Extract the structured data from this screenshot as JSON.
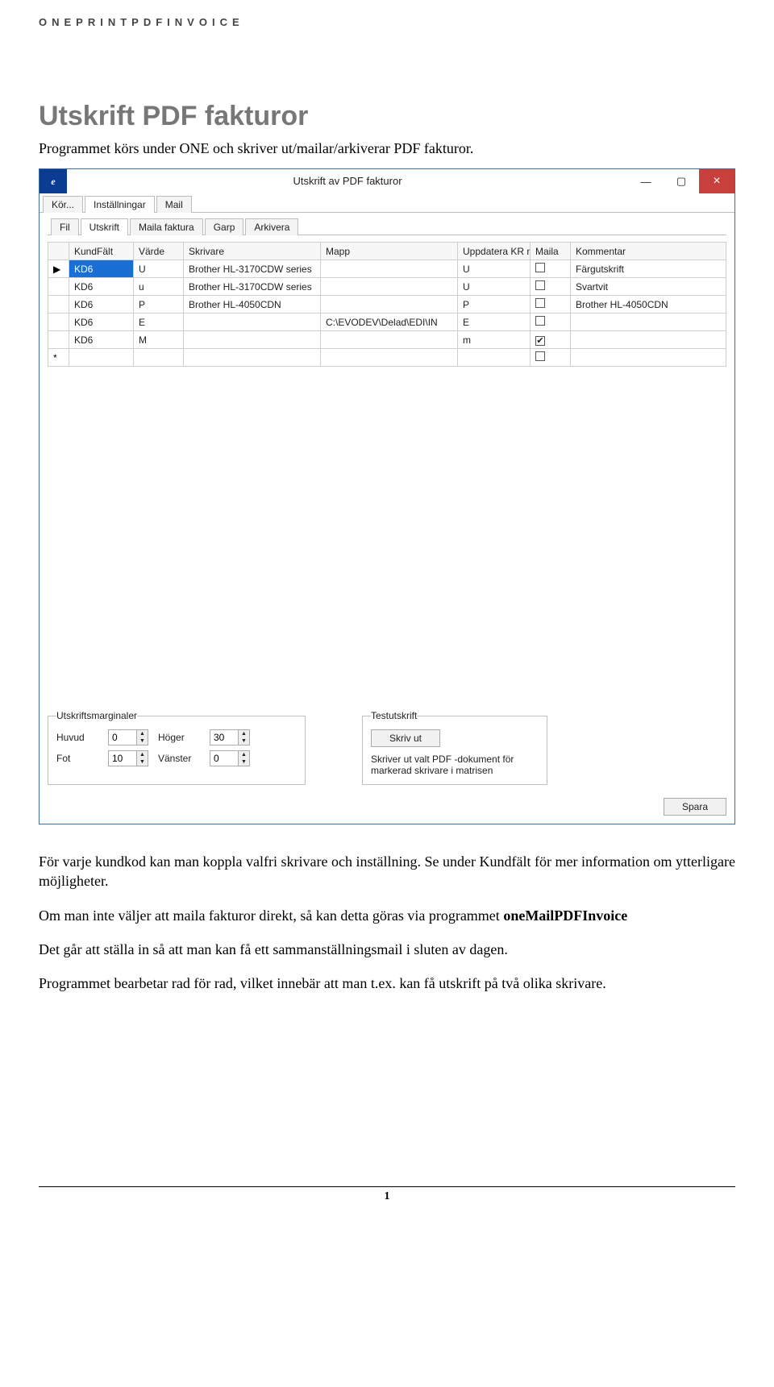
{
  "header_small": "ONEPRINTPDFINVOICE",
  "h1": "Utskrift PDF fakturor",
  "intro": "Programmet körs under ONE och skriver ut/mailar/arkiverar PDF fakturor.",
  "window": {
    "title": "Utskrift av PDF fakturor",
    "appicon_letter": "e",
    "min": "—",
    "max": "▢",
    "close": "×",
    "tabs_main": {
      "items": [
        "Kör...",
        "Inställningar",
        "Mail"
      ],
      "active": 1
    },
    "tabs_sub": {
      "items": [
        "Fil",
        "Utskrift",
        "Maila faktura",
        "Garp",
        "Arkivera"
      ],
      "active": 1
    },
    "grid": {
      "headers": [
        "KundFält",
        "Värde",
        "Skrivare",
        "Mapp",
        "Uppdatera KR med",
        "Maila",
        "Kommentar"
      ],
      "rows": [
        {
          "sel": "▶",
          "kund": "KD6",
          "varde": "U",
          "skrivare": "Brother HL-3170CDW series",
          "mapp": "",
          "upd": "U",
          "maila": false,
          "kom": "Färgutskrift",
          "selected": true
        },
        {
          "sel": "",
          "kund": "KD6",
          "varde": "u",
          "skrivare": "Brother HL-3170CDW series",
          "mapp": "",
          "upd": "U",
          "maila": false,
          "kom": "Svartvit"
        },
        {
          "sel": "",
          "kund": "KD6",
          "varde": "P",
          "skrivare": "Brother HL-4050CDN",
          "mapp": "",
          "upd": "P",
          "maila": false,
          "kom": "Brother HL-4050CDN"
        },
        {
          "sel": "",
          "kund": "KD6",
          "varde": "E",
          "skrivare": "",
          "mapp": "C:\\EVODEV\\Delad\\EDI\\IN",
          "upd": "E",
          "maila": false,
          "kom": ""
        },
        {
          "sel": "",
          "kund": "KD6",
          "varde": "M",
          "skrivare": "",
          "mapp": "",
          "upd": "m",
          "maila": true,
          "kom": ""
        }
      ],
      "newrow_marker": "*"
    },
    "margins": {
      "legend": "Utskriftsmarginaler",
      "huvud_label": "Huvud",
      "huvud": "0",
      "hoger_label": "Höger",
      "hoger": "30",
      "fot_label": "Fot",
      "fot": "10",
      "vanster_label": "Vänster",
      "vanster": "0"
    },
    "testprint": {
      "legend": "Testutskrift",
      "button": "Skriv ut",
      "hint": "Skriver ut valt PDF -dokument för markerad skrivare i matrisen"
    },
    "save": "Spara"
  },
  "body": {
    "p1a": "För varje kundkod kan man koppla valfri skrivare och inställning. Se under Kundfält för ",
    "p1b": "mer information om ytterligare möjligheter.",
    "p2a": "Om man inte väljer att maila fakturor direkt, så kan detta göras via programmet ",
    "p2b": "oneMailPDFInvoice",
    "p3": "Det går att ställa in så att man kan få ett sammanställningsmail i sluten av dagen.",
    "p4": "Programmet bearbetar rad för rad, vilket innebär att man t.ex. kan få utskrift på två olika skrivare."
  },
  "page_number": "1"
}
